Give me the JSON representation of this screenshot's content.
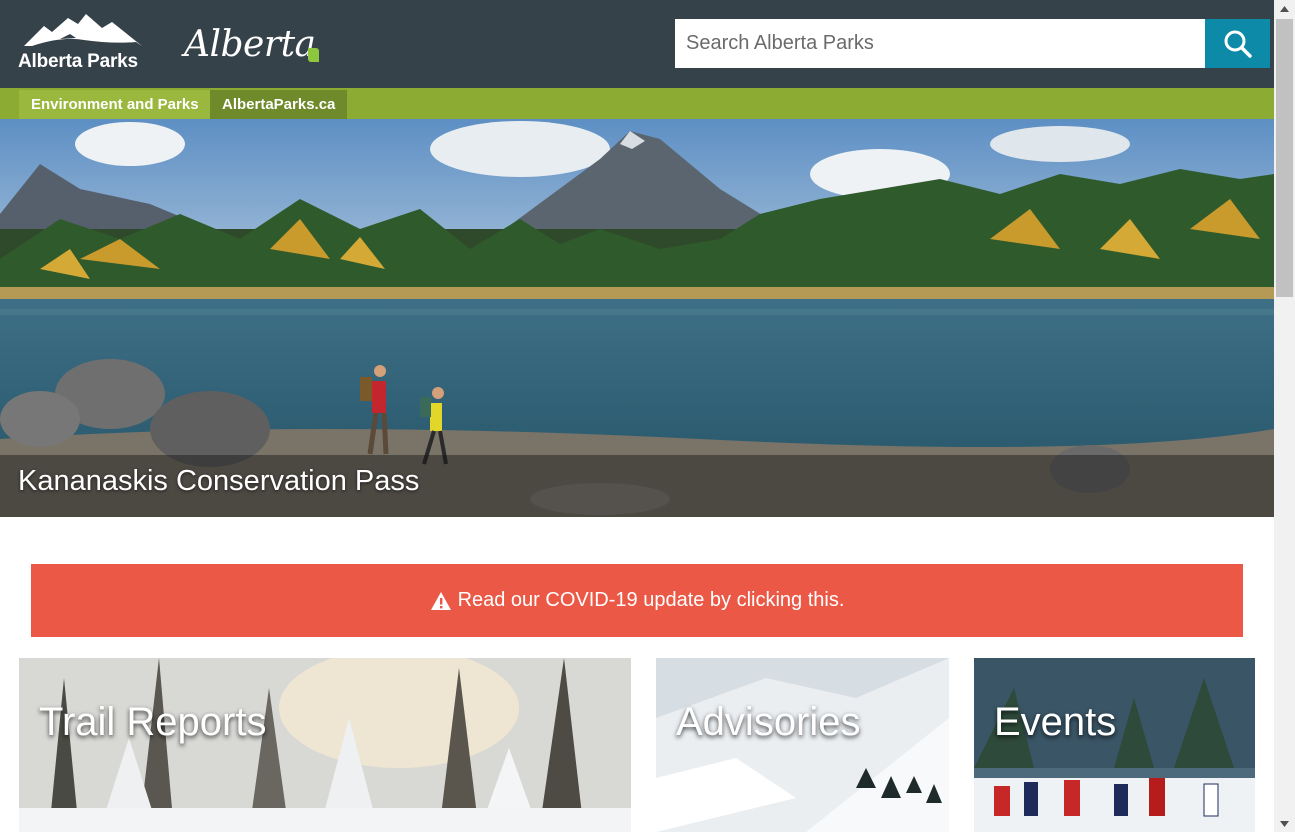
{
  "header": {
    "logo_text": "Alberta Parks",
    "gov_logo_text": "Alberta",
    "search": {
      "placeholder": "Search Alberta Parks",
      "value": "",
      "button_icon": "search-icon"
    }
  },
  "nav": {
    "tabs": [
      {
        "label": "Environment and Parks"
      },
      {
        "label": "AlbertaParks.ca"
      }
    ]
  },
  "hero": {
    "caption": "Kananaskis Conservation Pass",
    "image": "mountain-lake-hikers-image"
  },
  "alert": {
    "icon": "warning-triangle-icon",
    "text": "Read our COVID-19 update by clicking this."
  },
  "cards": [
    {
      "title": "Trail Reports",
      "image": "snowy-forest-image"
    },
    {
      "title": "Advisories",
      "image": "snowy-mountain-slope-image"
    },
    {
      "title": "Events",
      "image": "cross-country-skiers-image"
    }
  ],
  "colors": {
    "header_bg": "#36424a",
    "nav_green": "#8bab32",
    "search_button": "#0d8aa8",
    "alert_red": "#ec5846"
  }
}
